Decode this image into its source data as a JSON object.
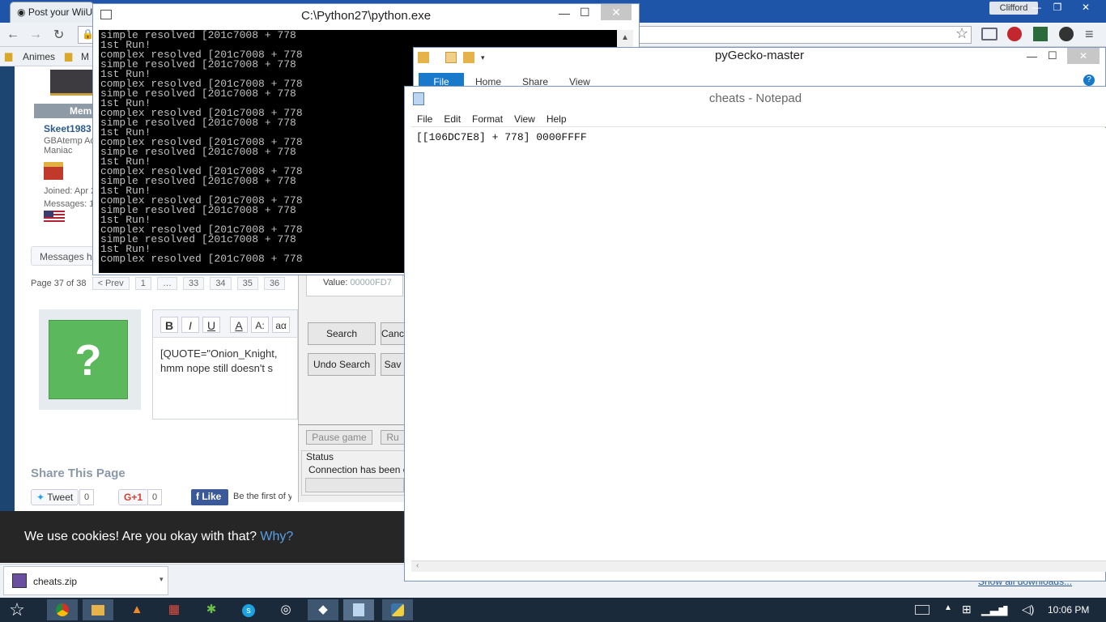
{
  "browser": {
    "tab1_title": "Post your WiiU",
    "user_name": "Clifford",
    "bookmarks": [
      "Animes",
      "M"
    ]
  },
  "forum": {
    "member_label": "Mem",
    "username": "Skeet1983",
    "user_title": "GBAtemp Adv",
    "user_rank": "Maniac",
    "joined": "Joined: Apr 2",
    "messages": "Messages: 1,5",
    "messages_button": "Messages ha",
    "page_info": "Page 37 of 38",
    "prev": "< Prev",
    "pages": [
      "1",
      "…",
      "33",
      "34",
      "35",
      "36"
    ],
    "avatar_placeholder": "?",
    "editor_buttons": [
      "B",
      "I",
      "U",
      "A",
      "A:",
      "aα"
    ],
    "editor_line1": "[QUOTE=\"Onion_Knight,",
    "editor_line2": "hmm nope still doesn't s",
    "share_title": "Share This Page",
    "tweet": "Tweet",
    "tweet_count": "0",
    "gplus": "G+1",
    "gplus_count": "0",
    "like": "Like",
    "be_first": "Be the first of y"
  },
  "cookie": {
    "text": "We use cookies! Are you okay with that?",
    "why": "Why?"
  },
  "downloads": {
    "file": "cheats.zip",
    "show_all": "Show all downloads..."
  },
  "pygecko_app": {
    "value_label": "Value:",
    "value": "00000FD7",
    "search": "Search",
    "cancel": "Canc",
    "undo_search": "Undo Search",
    "save": "Sav",
    "pause_game": "Pause game",
    "run": "Ru",
    "status_label": "Status",
    "status_text": "Connection has been clo"
  },
  "console": {
    "title": "C:\\Python27\\python.exe",
    "output": "simple resolved [201c7008 + 778\n1st Run!\ncomplex resolved [201c7008 + 778\nsimple resolved [201c7008 + 778\n1st Run!\ncomplex resolved [201c7008 + 778\nsimple resolved [201c7008 + 778\n1st Run!\ncomplex resolved [201c7008 + 778\nsimple resolved [201c7008 + 778\n1st Run!\ncomplex resolved [201c7008 + 778\nsimple resolved [201c7008 + 778\n1st Run!\ncomplex resolved [201c7008 + 778\nsimple resolved [201c7008 + 778\n1st Run!\ncomplex resolved [201c7008 + 778\nsimple resolved [201c7008 + 778\n1st Run!\ncomplex resolved [201c7008 + 778\nsimple resolved [201c7008 + 778\n1st Run!\ncomplex resolved [201c7008 + 778"
  },
  "explorer": {
    "title": "pyGecko-master",
    "tabs": [
      "File",
      "Home",
      "Share",
      "View"
    ]
  },
  "notepad": {
    "title": "cheats - Notepad",
    "menu": [
      "File",
      "Edit",
      "Format",
      "View",
      "Help"
    ],
    "content": "[[106DC7E8] + 778] 0000FFFF"
  },
  "taskbar": {
    "time": "10:06 PM"
  },
  "colors": {
    "chrome_frame": "#1f55a8",
    "ribbon_file": "#1979ca",
    "cookie_bg": "#262626",
    "link_blue": "#5aa0e6",
    "avatar_green": "#5cb85c",
    "taskbar": "#1b2a3a"
  },
  "icons": [
    "chrome-icon",
    "explorer-icon",
    "vlc-icon",
    "popcorn-icon",
    "app-icon",
    "skype-icon",
    "steam-icon",
    "game-icon",
    "notepad-icon",
    "python-icon",
    "star-icon",
    "keyboard-icon",
    "flag-icon",
    "network-icon",
    "volume-icon"
  ]
}
